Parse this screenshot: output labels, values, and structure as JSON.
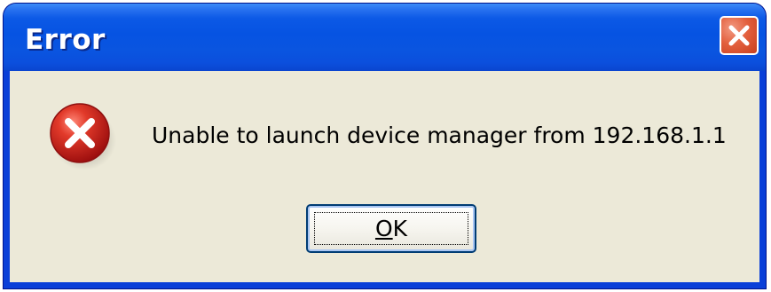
{
  "dialog": {
    "title": "Error",
    "message": "Unable to launch device manager from 192.168.1.1",
    "icon": "error-icon",
    "close_icon": "close-icon"
  },
  "buttons": {
    "ok": {
      "label": "OK",
      "mnemonic": "O",
      "rest": "K"
    }
  },
  "colors": {
    "titlebar": "#0653e2",
    "client": "#ece9d8",
    "close": "#e3603e",
    "error": "#d52a2a"
  }
}
